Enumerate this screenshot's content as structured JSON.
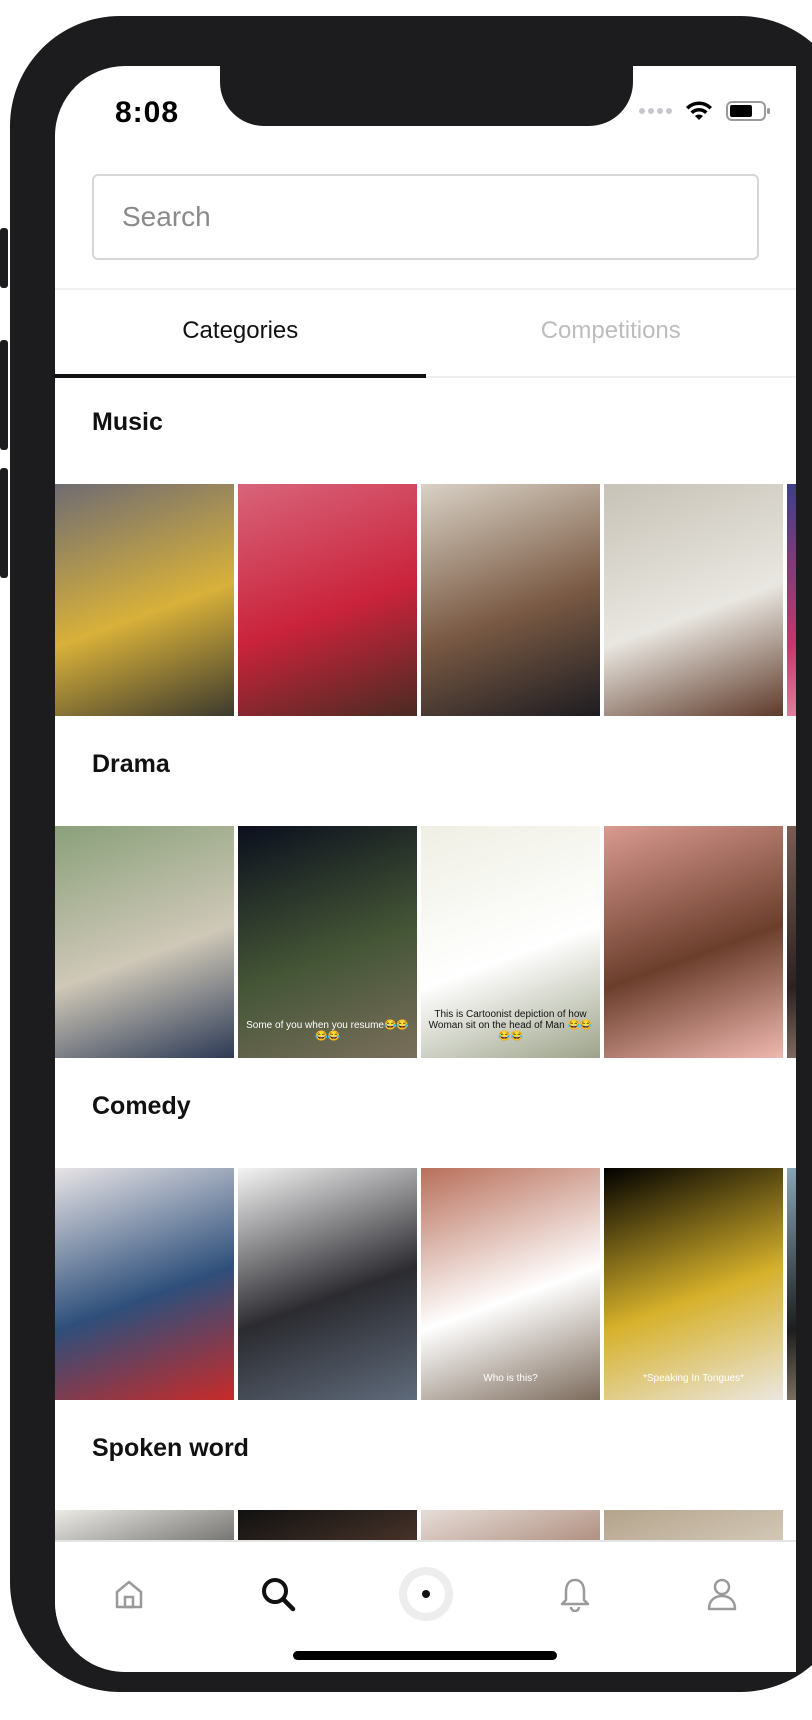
{
  "status_bar": {
    "time": "8:08"
  },
  "search": {
    "placeholder": "Search",
    "value": ""
  },
  "tabs": [
    {
      "label": "Categories",
      "active": true
    },
    {
      "label": "Competitions",
      "active": false
    }
  ],
  "sections": [
    {
      "title": "Music",
      "thumbnails": [
        {
          "colors": [
            "#6f6c73",
            "#d8b13a",
            "#3c3a2e"
          ],
          "caption": ""
        },
        {
          "colors": [
            "#d8647a",
            "#c9233b",
            "#4a2b22"
          ],
          "caption": ""
        },
        {
          "colors": [
            "#d9d2c6",
            "#7a5a44",
            "#1d1c21"
          ],
          "caption": ""
        },
        {
          "colors": [
            "#c7c2b6",
            "#e9e7e1",
            "#5e3a2a"
          ],
          "caption": ""
        },
        {
          "colors": [
            "#3b3f88",
            "#c9356b",
            "#f2c0c8"
          ],
          "caption": ""
        }
      ]
    },
    {
      "title": "Drama",
      "thumbnails": [
        {
          "colors": [
            "#8aa07a",
            "#cfc8b8",
            "#2d3a55"
          ],
          "caption": ""
        },
        {
          "colors": [
            "#0b0f1d",
            "#445536",
            "#7a6f5c"
          ],
          "caption": "Some of you when you resume😂😂😂😂"
        },
        {
          "colors": [
            "#efefe4",
            "#ffffff",
            "#9da38a"
          ],
          "caption": "This is Cartoonist depiction of how Woman sit on the head of Man 😂😂😂😂"
        },
        {
          "colors": [
            "#d99a8f",
            "#6b3e2c",
            "#f0b8b0"
          ],
          "caption": ""
        },
        {
          "colors": [
            "#7a5c55",
            "#2b2220",
            "#c9a89b"
          ],
          "caption": ""
        }
      ]
    },
    {
      "title": "Comedy",
      "thumbnails": [
        {
          "colors": [
            "#e8e4e6",
            "#2e4f7a",
            "#c82a2a"
          ],
          "caption": ""
        },
        {
          "colors": [
            "#f4f4f4",
            "#2b2b30",
            "#5f6a7a"
          ],
          "caption": ""
        },
        {
          "colors": [
            "#b86f5a",
            "#ffffff",
            "#7c6b5c"
          ],
          "caption": "Who is this?"
        },
        {
          "colors": [
            "#000000",
            "#d6b12b",
            "#ebe7e0"
          ],
          "caption": "*Speaking In Tongues*"
        },
        {
          "colors": [
            "#8aa7b8",
            "#1d1d1d",
            "#c9b79b"
          ],
          "caption": ""
        }
      ]
    },
    {
      "title": "Spoken word",
      "thumbnails": [
        {
          "colors": [
            "#ecebe6",
            "#222222",
            "#bdbab2"
          ],
          "caption": ""
        },
        {
          "colors": [
            "#111111",
            "#6b4a3a",
            "#222222"
          ],
          "caption": ""
        },
        {
          "colors": [
            "#e6ddd8",
            "#8a5a44",
            "#d3c6bd"
          ],
          "caption": ""
        },
        {
          "colors": [
            "#b4a48c",
            "#e8e0d4",
            "#5a3f2e"
          ],
          "caption": ""
        }
      ]
    }
  ],
  "bottom_nav": [
    {
      "name": "home",
      "icon": "home-icon",
      "active": false
    },
    {
      "name": "search",
      "icon": "search-icon",
      "active": true
    },
    {
      "name": "record",
      "icon": "record-icon",
      "active": false
    },
    {
      "name": "notifications",
      "icon": "bell-icon",
      "active": false
    },
    {
      "name": "profile",
      "icon": "profile-icon",
      "active": false
    }
  ]
}
